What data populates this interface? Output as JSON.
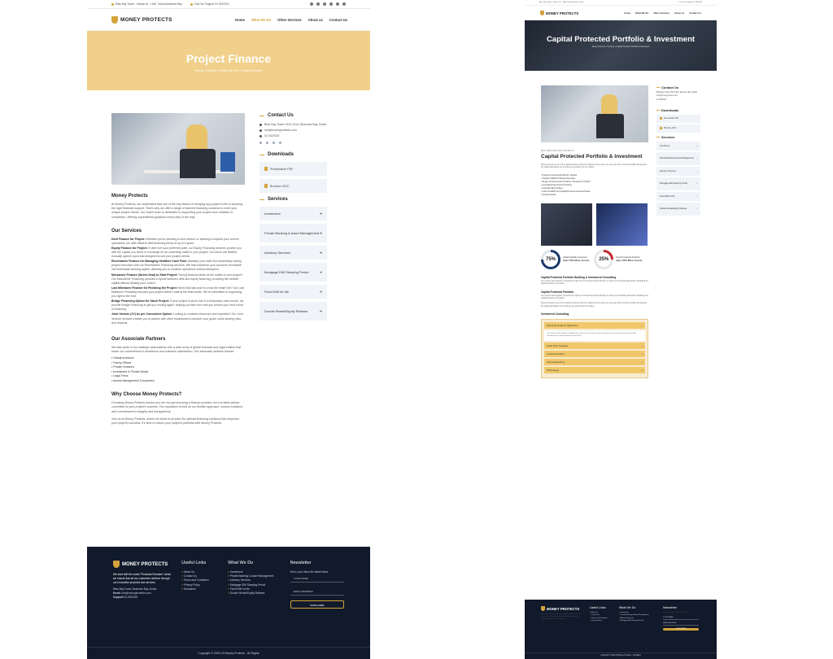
{
  "topbar": {
    "address": "Bliss Bay Tower - Marasi Dr - UAE, Dubai-Business Bay",
    "support": "Call Our Support 04 3320324"
  },
  "brand": "MONEY PROTECTS",
  "nav": [
    "Home",
    "What We Do",
    "Other Services",
    "About us",
    "Contact Us"
  ],
  "left": {
    "hero_title": "Project Finance",
    "breadcrumb": "Money Protects » What We Do » Project Finance",
    "h_mp": "Money Protects",
    "p_mp": "At Money Protects, we understand that one of the key factors in bringing any project to life is securing the right financial support. That's why we offer a range of tailored financing solutions to meet your unique project needs. Our expert team is dedicated to supporting your project from initiation to completion, offering unparalleled guidance every step of the way.",
    "h_os": "Our Services",
    "services": [
      {
        "t": "Debt Finance for Project:",
        "d": "Whether you're planning a new venture or seeking to expand your current operations, we offer efficient debt financing terms of up to 6 years."
      },
      {
        "t": "Equity Finance for Project:",
        "d": "If debt isn't your preferred path, our Equity Financing services provide you with the capital you need, in exchange for an ownership stake in your project. Our terms are flexible, mutually agreed upon and designed to suit your project needs."
      },
      {
        "t": "Receivables Finance for Managing Healthier Cash Flow:",
        "d": "Maintain your cash flow seamlessly during project execution with our Receivables Financing services. We help transform your accounts receivable into immediate working capital, allowing you to continue operations without disruption."
      },
      {
        "t": "Mezzanine Finance (Stress Deal) to Start Project:",
        "d": "Facing financial strain at the outset of your project? Our Mezzanine Financing provides a hybrid between debt and equity financing, providing the needed capital without diluting your control."
      },
      {
        "t": "Last Milestone Finance for Finishing the Project:",
        "d": "Need that last push to cross the finish line? Our Last Milestone Financing ensures your project doesn't stall at the final hurdle. We're committed to supporting you right to the end."
      },
      {
        "t": "Bridge Financing Option for Stuck Project:",
        "d": "If your project is stuck due to a temporary cash crunch, we provide Bridge Financing to get you moving again, helping you tide over until you secure your next round of financing."
      },
      {
        "t": "Joint Venture (JV) As per Convenient Option:",
        "d": "Looking to combine resources and expertise? Our Joint Venture services enable you to partner with other businesses to achieve your goals, while sharing risks and rewards."
      }
    ],
    "h_ap": "Our Associate Partners",
    "p_ap": "We take pride in our strategic associations with a wide array of global financial and legal entities that share our commitment to excellence and customer satisfaction. Our associate partners include:",
    "partners": [
      "Global Investors",
      "Family Offices",
      "Private Investors",
      "Investment & Private Banks",
      "Legal Firms",
      "Assets Management Companies"
    ],
    "h_wc": "Why Choose Money Protects?",
    "p_wc1": "Choosing Money Protects means you are not just choosing a finance provider, but a trusted partner committed to your project's success. Our reputation is built on our flexible approach, custom solutions, and commitment to integrity and transparency.",
    "p_wc2": "Join us at Money Protects, where we strive to provide the optimal financing solutions that empower your project's success. It's time to unlock your project's potential with Money Protects."
  },
  "sidebar": {
    "contact_title": "Contact Us",
    "address": "Bliss Bay Tower 1613,1614, Business Bay, Dubai",
    "email": "info@moneyprotects.com",
    "phone": "04 3320324",
    "downloads_title": "Downloads",
    "downloads": [
      "Presentation PDF",
      "Brochure DOC"
    ],
    "services_title": "Services",
    "services": [
      "Investment",
      "Private Banking & Asset Management",
      "Advisory Services",
      "Mortgage EMI Sleeping Period",
      "Fixed EMI for life",
      "Double Rental/Equity Release"
    ]
  },
  "footer": {
    "about": "We start with the motto \"Financial Freedom\" which we ensure that all our customers achieve through our innovative products and services.",
    "address": "Bliss Bay Tower, Business Bay, Dubai",
    "email_label": "Email:",
    "email": "info@moneyprotects.com",
    "support_label": "Support:",
    "support": "04-3320324",
    "useful_title": "Useful Links",
    "useful": [
      "About Us",
      "Contact Us",
      "Terms and Conditions",
      "Privacy Policy",
      "Disclaimer"
    ],
    "wwd_title": "What We Do",
    "wwd": [
      "Investment",
      "Private Banking & Asset Management",
      "Advisory Services",
      "Mortgage EMI Sleeping Period",
      "Fixed EMI for life",
      "Double Rental/Equity Release"
    ],
    "news_title": "Newsletter",
    "news_text": "Get in your inbox the latest News",
    "name_ph": "YOUR NAME",
    "email_ph": "EMAIL ADDRESS",
    "subscribe": "SUBSCRIBE",
    "copyright": "Copyright © 2020-23 Money Protects - All Rights"
  },
  "right": {
    "hero_title": "Capital Protected Portfolio & Investment",
    "breadcrumb": "Money Protects » Services » Capital Protected Portfolio & Investment",
    "sub": "BEST SERVICES FROM PROTECTS",
    "title": "Capital Protected Portfolio & Investment",
    "intro": "Money Protects is one of the capital investment firms for highest returns where we use best tools to build a portfolio that protects the capital and allows you to achieve the upside from the market.",
    "points": [
      "Protection & Ownership Bonds / Sukuks",
      "Treasure Inflation Protected Securities",
      "All type of Fixed Income Products / Structured or Hybrid",
      "Leveraged Fixed Income Products",
      "Corporate Bond Indices",
      "Index Fund/ETF and Capital Protected structured Notes",
      "Dividend Stocks"
    ],
    "stat1_val": "75%",
    "stat1_label": "Global Flexibility Investment",
    "stat1_sub": "Upto 75% More Assets",
    "stat2_val": "25%",
    "stat2_label": "Security Financial Solutions",
    "stat2_sub": "Upto 25% More Assets",
    "h_cp": "Capital Protected Portfolio Building & Investment Consulting",
    "h_cpp": "Capital Protected Portfolio",
    "h_ic": "Investment Consulting",
    "acc_open": "Financial Goals & Objectives",
    "acc_items": [
      "Cash Flow Analysis",
      "Investment Plan",
      "Client Reporting",
      "Technology"
    ],
    "body": "Our experts work together to identify the right mix of investments that will help you reach your financial goals while maintaining the capital protection you desire."
  }
}
